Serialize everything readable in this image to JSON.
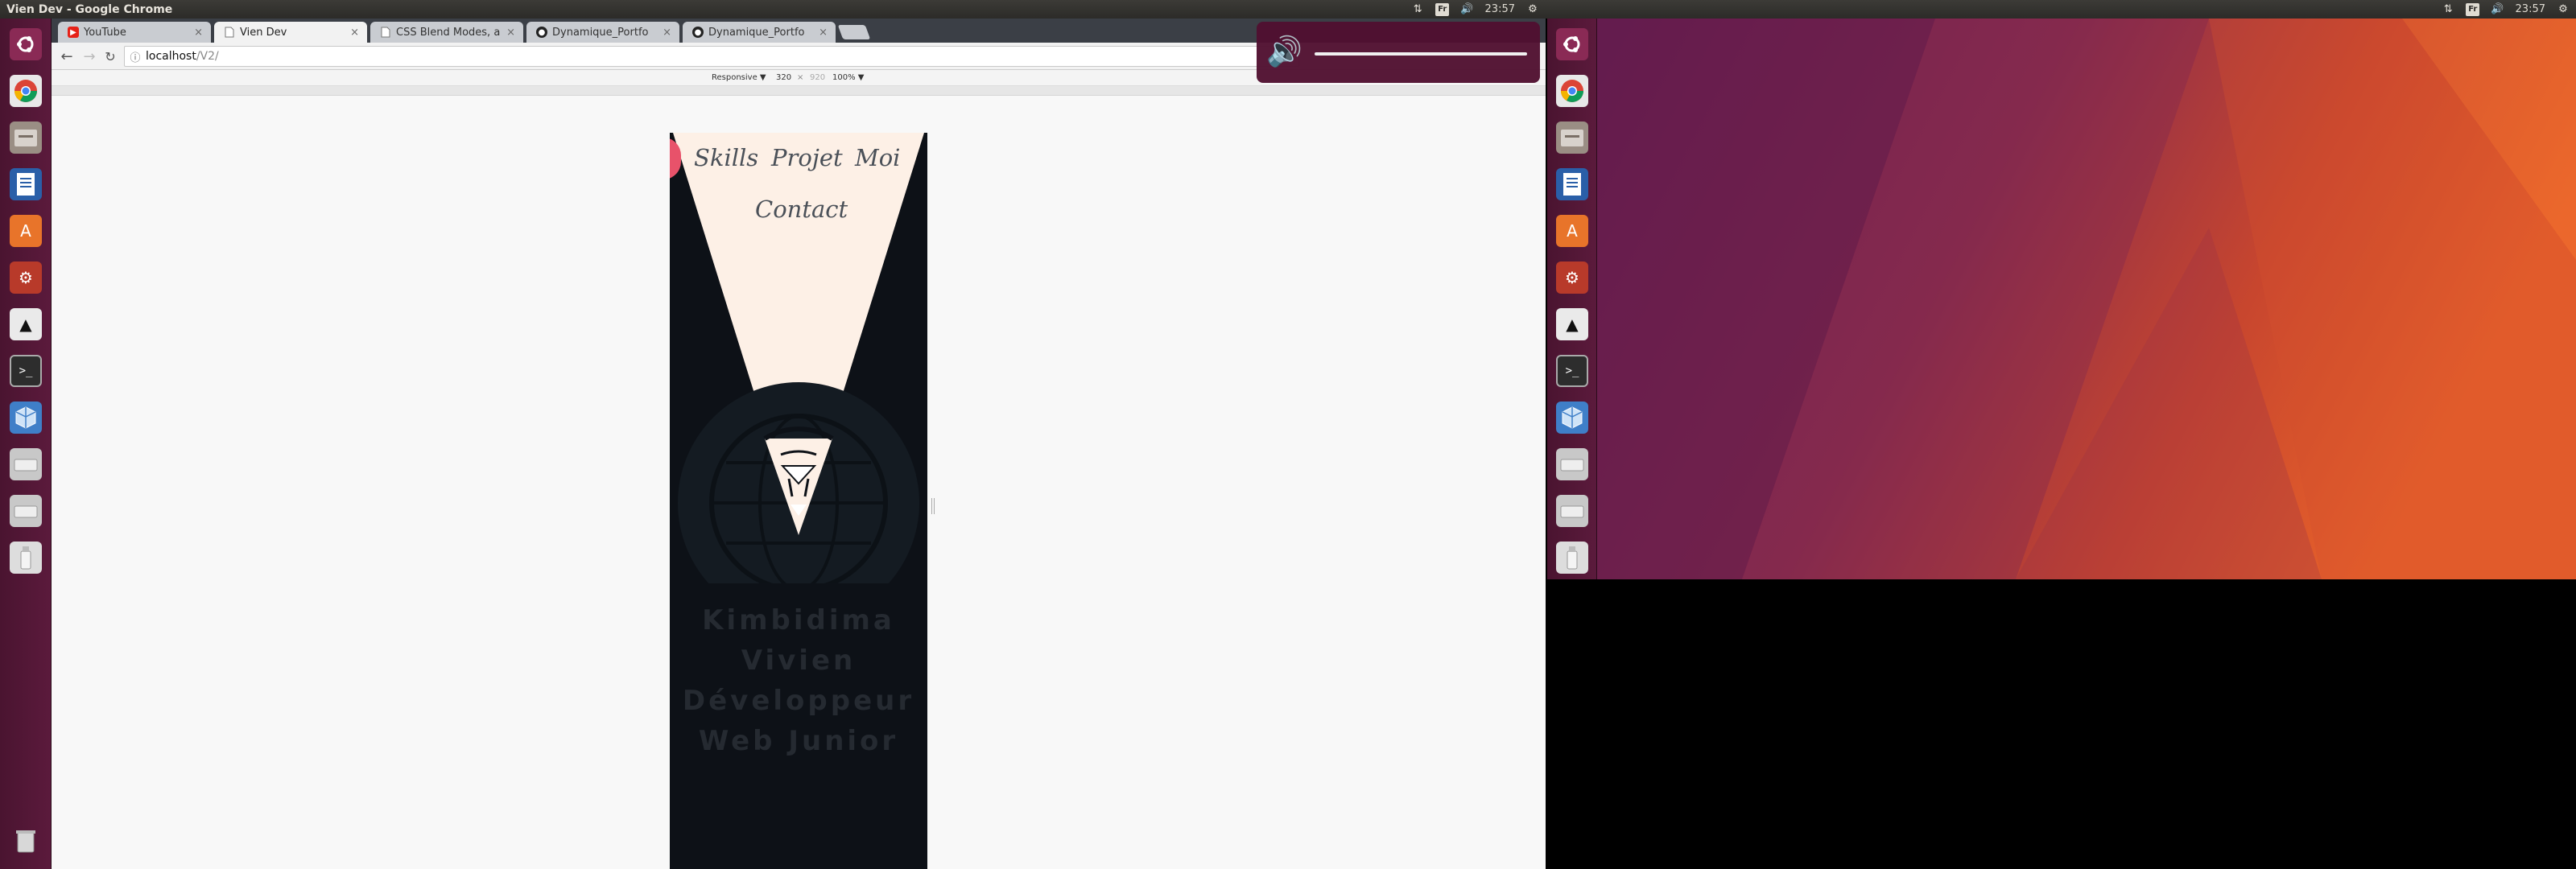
{
  "left_panel": {
    "window_title": "Vien Dev - Google Chrome",
    "keyboard_layout": "Fr",
    "time": "23:57"
  },
  "right_panel": {
    "keyboard_layout": "Fr",
    "time": "23:57"
  },
  "launcher_icons": [
    "ubuntu-dash-icon",
    "chrome-icon",
    "files-icon",
    "writer-icon",
    "software-center-icon",
    "system-settings-icon",
    "inkscape-icon",
    "terminal-icon",
    "virtualbox-icon",
    "drive-icon",
    "drive-icon",
    "usb-icon",
    "trash-icon"
  ],
  "tabs": [
    {
      "label": "YouTube",
      "favicon": "youtube-icon"
    },
    {
      "label": "Vien Dev",
      "favicon": "page-icon"
    },
    {
      "label": "CSS Blend Modes, a",
      "favicon": "page-icon"
    },
    {
      "label": "Dynamique_Portfo",
      "favicon": "github-icon"
    },
    {
      "label": "Dynamique_Portfo",
      "favicon": "github-icon"
    }
  ],
  "active_tab_index": 1,
  "address": {
    "host": "localhost",
    "path": "/V2/"
  },
  "devtools": {
    "device": "Responsive ▼",
    "width": "320",
    "separator": "×",
    "height": "920",
    "zoom": "100% ▼"
  },
  "site": {
    "nav": {
      "skills": "Skills",
      "projet": "Projet",
      "moi": "Moi",
      "contact": "Contact"
    },
    "name_lines": [
      "Kimbidima",
      "Vivien",
      "Développeur",
      "Web Junior"
    ]
  },
  "colors": {
    "ubuntu_purple": "#5b1a3c",
    "site_bg": "#0d1117",
    "cone_light": "#fdf0e6",
    "blob_red": "#e8526a"
  }
}
